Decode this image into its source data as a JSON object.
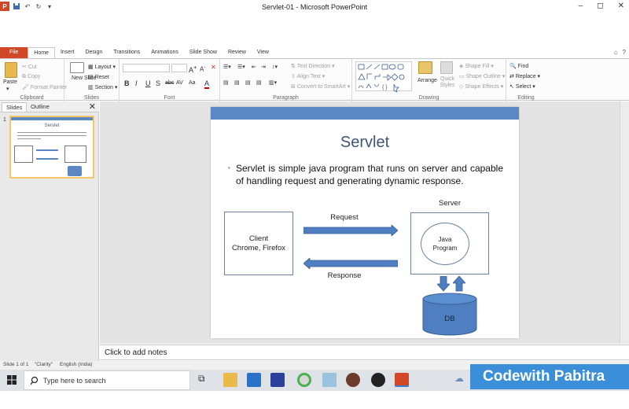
{
  "window": {
    "title": "Servlet-01 - Microsoft PowerPoint",
    "controls": [
      "–",
      "◻",
      "✕"
    ]
  },
  "ribbon": {
    "tabs": [
      "File",
      "Home",
      "Insert",
      "Design",
      "Transitions",
      "Animations",
      "Slide Show",
      "Review",
      "View"
    ],
    "active_tab": "Home",
    "clipboard": {
      "paste": "Paste",
      "cut": "Cut",
      "copy": "Copy",
      "format_painter": "Format Painter",
      "label": "Clipboard"
    },
    "slides": {
      "new_slide": "New Slide",
      "layout": "Layout",
      "reset": "Reset",
      "section": "Section",
      "label": "Slides"
    },
    "font": {
      "label": "Font",
      "buttons": [
        "B",
        "I",
        "U",
        "S",
        "abc",
        "AV",
        "Aa",
        "A"
      ]
    },
    "paragraph": {
      "label": "Paragraph",
      "text_direction": "Text Direction",
      "align_text": "Align Text",
      "convert_smartart": "Convert to SmartArt"
    },
    "drawing": {
      "arrange": "Arrange",
      "quick_styles": "Quick Styles",
      "shape_fill": "Shape Fill",
      "shape_outline": "Shape Outline",
      "shape_effects": "Shape Effects",
      "label": "Drawing"
    },
    "editing": {
      "find": "Find",
      "replace": "Replace",
      "select": "Select",
      "label": "Editing"
    }
  },
  "left_pane": {
    "tabs": [
      "Slides",
      "Outline"
    ],
    "active_tab": "Slides",
    "thumbnail_number": "1",
    "thumbnail_title": "Servlet"
  },
  "slide": {
    "title": "Servlet",
    "bullet": "Servlet is simple java program that runs on server and capable of handling request and generating dynamic response.",
    "diagram": {
      "client_line1": "Client",
      "client_line2": "Chrome, Firefox",
      "server_label": "Server",
      "java_line1": "Java",
      "java_line2": "Program",
      "request_label": "Request",
      "response_label": "Response",
      "db_label": "DB"
    },
    "accent_color": "#5b87c5"
  },
  "notes": {
    "placeholder": "Click to add notes"
  },
  "status_bar": {
    "slide_of": "Slide 1 of 1",
    "theme": "\"Clarity\"",
    "language": "English (India)"
  },
  "taskbar": {
    "search_placeholder": "Type here to search"
  },
  "overlay": {
    "brand": "Codewith Pabitra"
  }
}
